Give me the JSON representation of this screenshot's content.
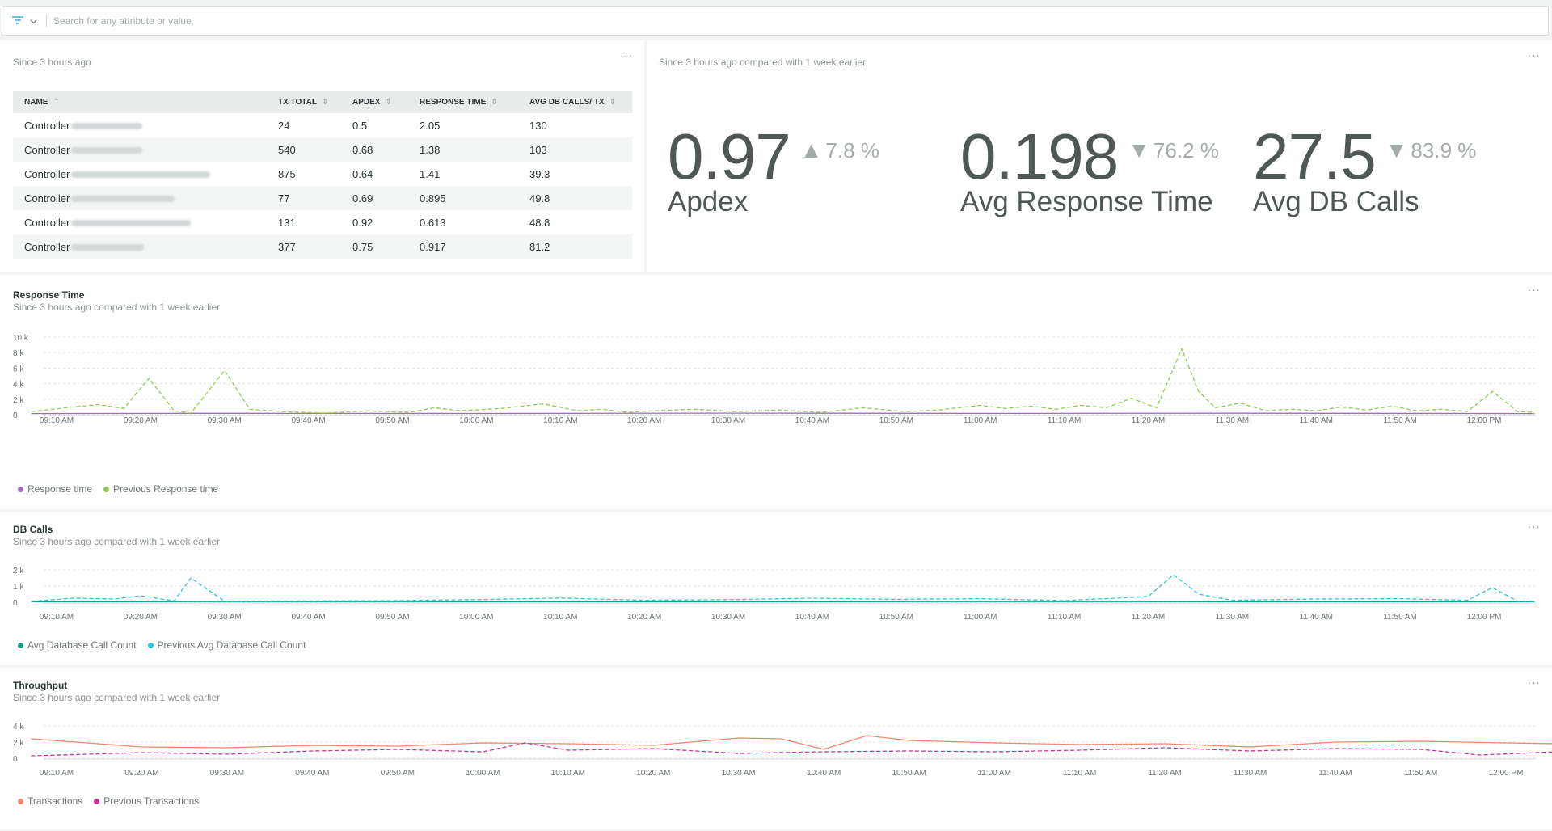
{
  "search": {
    "placeholder": "Search for any attribute or value."
  },
  "table_card": {
    "subtitle": "Since 3 hours ago",
    "columns": [
      "NAME",
      "TX TOTAL",
      "APDEX",
      "RESPONSE TIME",
      "AVG DB CALLS/ TX"
    ],
    "rows": [
      {
        "name": "Controller",
        "tx": "24",
        "apdex": "0.5",
        "rt": "2.05",
        "db": "130"
      },
      {
        "name": "Controller",
        "tx": "540",
        "apdex": "0.68",
        "rt": "1.38",
        "db": "103"
      },
      {
        "name": "Controller",
        "tx": "875",
        "apdex": "0.64",
        "rt": "1.41",
        "db": "39.3"
      },
      {
        "name": "Controller",
        "tx": "77",
        "apdex": "0.69",
        "rt": "0.895",
        "db": "49.8"
      },
      {
        "name": "Controller",
        "tx": "131",
        "apdex": "0.92",
        "rt": "0.613",
        "db": "48.8"
      },
      {
        "name": "Controller",
        "tx": "377",
        "apdex": "0.75",
        "rt": "0.917",
        "db": "81.2"
      }
    ]
  },
  "billboard": {
    "subtitle": "Since 3 hours ago compared with 1 week earlier",
    "metrics": [
      {
        "value": "0.97",
        "change": "7.8 %",
        "direction": "up",
        "label": "Apdex"
      },
      {
        "value": "0.198",
        "change": "76.2 %",
        "direction": "down",
        "label": "Avg Response Time"
      },
      {
        "value": "27.5",
        "change": "83.9 %",
        "direction": "down",
        "label": "Avg DB Calls"
      }
    ]
  },
  "menu_glyph": "···",
  "time_ticks": [
    "09:10 AM",
    "09:20 AM",
    "09:30 AM",
    "09:40 AM",
    "09:50 AM",
    "10:00 AM",
    "10:10 AM",
    "10:20 AM",
    "10:30 AM",
    "10:40 AM",
    "10:50 AM",
    "11:00 AM",
    "11:10 AM",
    "11:20 AM",
    "11:30 AM",
    "11:40 AM",
    "11:50 AM",
    "12:00 PM"
  ],
  "charts": {
    "response": {
      "title": "Response Time",
      "subtitle": "Since 3 hours ago compared with 1 week earlier",
      "legend": [
        "Response time",
        "Previous Response time"
      ]
    },
    "db": {
      "title": "DB Calls",
      "subtitle": "Since 3 hours ago compared with 1 week earlier",
      "legend": [
        "Avg Database Call Count",
        "Previous Avg Database Call Count"
      ]
    },
    "throughput": {
      "title": "Throughput",
      "subtitle": "Since 3 hours ago compared with 1 week earlier",
      "legend": [
        "Transactions",
        "Previous Transactions"
      ]
    }
  },
  "chart_data": [
    {
      "type": "line",
      "title": "Response Time",
      "ylim": [
        0,
        10000
      ],
      "y_ticks": [
        "0",
        "2 k",
        "4 k",
        "6 k",
        "8 k",
        "10 k"
      ],
      "y_tick_values": [
        0,
        2000,
        4000,
        6000,
        8000,
        10000
      ],
      "x_range": [
        "09:07 AM",
        "12:06 PM"
      ],
      "series": [
        {
          "name": "Response time",
          "color": "#a566c8",
          "dashed": false,
          "x": [
            "09:07",
            "09:30",
            "10:00",
            "10:30",
            "11:00",
            "11:30",
            "12:00",
            "12:06"
          ],
          "values": [
            150,
            180,
            160,
            200,
            170,
            190,
            160,
            150
          ]
        },
        {
          "name": "Previous Response time",
          "color": "#93c955",
          "dashed": true,
          "x": [
            "09:07",
            "09:12",
            "09:15",
            "09:18",
            "09:21",
            "09:24",
            "09:26",
            "09:30",
            "09:33",
            "09:37",
            "09:42",
            "09:47",
            "09:52",
            "09:55",
            "09:58",
            "10:03",
            "10:08",
            "10:12",
            "10:15",
            "10:18",
            "10:21",
            "10:26",
            "10:31",
            "10:36",
            "10:41",
            "10:46",
            "10:51",
            "10:55",
            "11:00",
            "11:03",
            "11:06",
            "11:09",
            "11:12",
            "11:15",
            "11:18",
            "11:21",
            "11:24",
            "11:26",
            "11:28",
            "11:31",
            "11:34",
            "11:37",
            "11:40",
            "11:43",
            "11:46",
            "11:49",
            "11:52",
            "11:55",
            "11:58",
            "12:01",
            "12:04",
            "12:06"
          ],
          "values": [
            400,
            1000,
            1300,
            800,
            4700,
            500,
            200,
            5700,
            700,
            400,
            200,
            500,
            300,
            900,
            500,
            800,
            1400,
            500,
            700,
            300,
            500,
            700,
            400,
            600,
            300,
            900,
            400,
            600,
            1200,
            800,
            1100,
            700,
            1200,
            900,
            2100,
            900,
            8500,
            3000,
            900,
            1500,
            500,
            700,
            500,
            1000,
            600,
            1100,
            500,
            700,
            400,
            3000,
            400,
            300
          ]
        }
      ]
    },
    {
      "type": "line",
      "title": "DB Calls",
      "ylim": [
        0,
        2000
      ],
      "y_ticks": [
        "0",
        "1 k",
        "2 k"
      ],
      "y_tick_values": [
        0,
        1000,
        2000
      ],
      "x_range": [
        "09:07 AM",
        "12:06 PM"
      ],
      "series": [
        {
          "name": "Avg Database Call Count",
          "color": "#1a9c8a",
          "dashed": false,
          "x": [
            "09:07",
            "09:30",
            "10:00",
            "10:30",
            "11:00",
            "11:30",
            "12:00",
            "12:06"
          ],
          "values": [
            30,
            40,
            35,
            30,
            40,
            35,
            30,
            30
          ]
        },
        {
          "name": "Previous Avg Database Call Count",
          "color": "#2ec5d8",
          "dashed": true,
          "x": [
            "09:07",
            "09:12",
            "09:17",
            "09:20",
            "09:24",
            "09:26",
            "09:30",
            "09:40",
            "09:50",
            "10:00",
            "10:10",
            "10:20",
            "10:30",
            "10:40",
            "10:50",
            "11:00",
            "11:10",
            "11:20",
            "11:23",
            "11:26",
            "11:30",
            "11:40",
            "11:50",
            "11:58",
            "12:01",
            "12:04",
            "12:06"
          ],
          "values": [
            60,
            250,
            200,
            400,
            80,
            1500,
            60,
            80,
            100,
            160,
            260,
            120,
            160,
            250,
            180,
            220,
            100,
            350,
            1700,
            500,
            120,
            200,
            220,
            120,
            900,
            60,
            60
          ]
        }
      ]
    },
    {
      "type": "line",
      "title": "Throughput",
      "ylim": [
        0,
        4000
      ],
      "y_ticks": [
        "0",
        "2 k",
        "4 k"
      ],
      "y_tick_values": [
        0,
        2000,
        4000
      ],
      "x_range": [
        "09:07 AM",
        "12:06 PM"
      ],
      "series": [
        {
          "name": "Transactions",
          "color": "#f5866a",
          "dashed": false,
          "x": [
            "09:07",
            "09:20",
            "09:30",
            "09:40",
            "09:50",
            "10:00",
            "10:10",
            "10:20",
            "10:30",
            "10:35",
            "10:40",
            "10:45",
            "10:50",
            "11:00",
            "11:10",
            "11:20",
            "11:30",
            "11:40",
            "11:50",
            "12:00",
            "12:06"
          ],
          "values": [
            2400,
            1400,
            1300,
            1600,
            1500,
            1900,
            1800,
            1600,
            2500,
            2400,
            1100,
            2800,
            2200,
            1900,
            1700,
            1800,
            1400,
            2000,
            2100,
            1900,
            1800
          ]
        },
        {
          "name": "Previous Transactions",
          "color": "#c8359a",
          "dashed": true,
          "x": [
            "09:07",
            "09:20",
            "09:30",
            "09:40",
            "09:50",
            "10:00",
            "10:05",
            "10:10",
            "10:20",
            "10:30",
            "10:40",
            "10:50",
            "11:00",
            "11:10",
            "11:20",
            "11:30",
            "11:40",
            "11:50",
            "11:57",
            "12:06"
          ],
          "values": [
            300,
            700,
            500,
            900,
            1100,
            800,
            1900,
            1000,
            1200,
            600,
            800,
            900,
            800,
            1000,
            1300,
            900,
            1200,
            1100,
            400,
            800
          ]
        }
      ]
    }
  ]
}
